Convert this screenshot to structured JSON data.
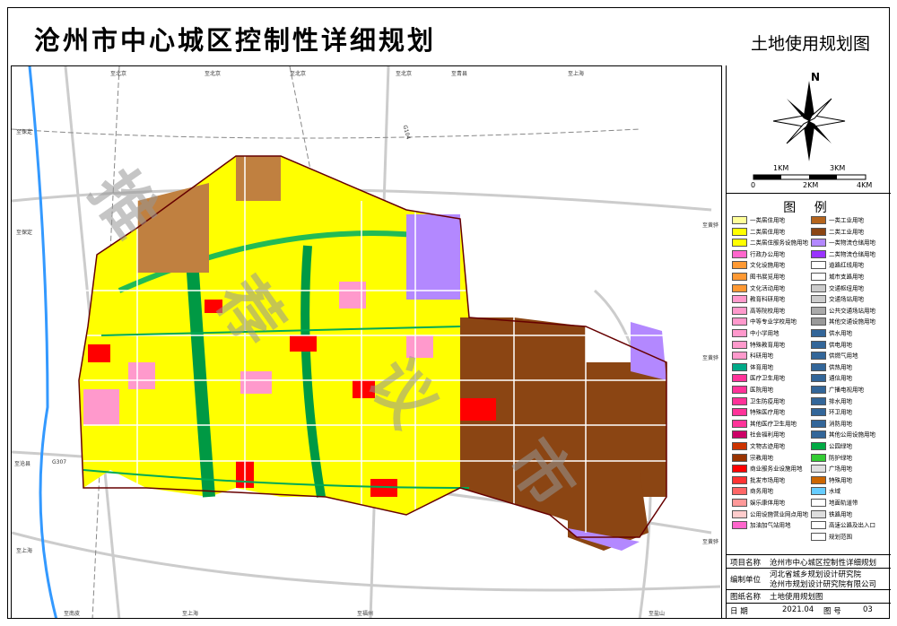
{
  "header": {
    "title": "沧州市中心城区控制性详细规划",
    "subtitle": "土地使用规划图"
  },
  "map": {
    "labels": [
      "至北京",
      "至北京",
      "至北京",
      "至北京",
      "至青县",
      "至上海",
      "至保定",
      "至保定",
      "至黄骅",
      "至黄骅",
      "至沧县",
      "G307",
      "至上海",
      "至南皮",
      "至上海",
      "至盐山",
      "至福州",
      "至黄骅",
      "G104"
    ],
    "watermark": [
      "推",
      "荐",
      "议",
      "市"
    ]
  },
  "compass": {
    "north": "N",
    "scale_top": [
      "1KM",
      "3KM"
    ],
    "scale_bottom": [
      "0",
      "2KM",
      "4KM"
    ]
  },
  "legend": {
    "title": "图 例",
    "left": [
      {
        "label": "一类居住用地",
        "color": "#ffff99"
      },
      {
        "label": "二类居住用地",
        "color": "#ffff00"
      },
      {
        "label": "二类居住服务设施用地",
        "color": "#ffff00"
      },
      {
        "label": "行政办公用地",
        "color": "#ff66cc"
      },
      {
        "label": "文化设施用地",
        "color": "#ff9933"
      },
      {
        "label": "图书展览用地",
        "color": "#ff9933"
      },
      {
        "label": "文化活动用地",
        "color": "#ff9933"
      },
      {
        "label": "教育科研用地",
        "color": "#ff99cc"
      },
      {
        "label": "高等院校用地",
        "color": "#ff99cc"
      },
      {
        "label": "中等专业学校用地",
        "color": "#ff99cc"
      },
      {
        "label": "中小学用地",
        "color": "#ff99cc"
      },
      {
        "label": "特殊教育用地",
        "color": "#ff99cc"
      },
      {
        "label": "科研用地",
        "color": "#ff99cc"
      },
      {
        "label": "体育用地",
        "color": "#00aa88"
      },
      {
        "label": "医疗卫生用地",
        "color": "#ff3399"
      },
      {
        "label": "医院用地",
        "color": "#ff3399"
      },
      {
        "label": "卫生防疫用地",
        "color": "#ff3399"
      },
      {
        "label": "特殊医疗用地",
        "color": "#ff3399"
      },
      {
        "label": "其他医疗卫生用地",
        "color": "#ff3399"
      },
      {
        "label": "社会福利用地",
        "color": "#cc0066"
      },
      {
        "label": "文物古迹用地",
        "color": "#cc3300"
      },
      {
        "label": "宗教用地",
        "color": "#993300"
      },
      {
        "label": "商业服务业设施用地",
        "color": "#ff0000"
      },
      {
        "label": "批发市场用地",
        "color": "#ff3333"
      },
      {
        "label": "商务用地",
        "color": "#ff6666"
      },
      {
        "label": "娱乐康体用地",
        "color": "#ff9999"
      },
      {
        "label": "公用设施营业网点用地",
        "color": "#ffcccc"
      },
      {
        "label": "加油加气站用地",
        "color": "#ff66cc"
      }
    ],
    "right": [
      {
        "label": "一类工业用地",
        "color": "#b5651d"
      },
      {
        "label": "二类工业用地",
        "color": "#8b4513"
      },
      {
        "label": "一类物流仓储用地",
        "color": "#b388ff"
      },
      {
        "label": "二类物流仓储用地",
        "color": "#9933ff"
      },
      {
        "label": "道路红线用地",
        "color": "#ffffff"
      },
      {
        "label": "城市支路用地",
        "color": "#ffffff"
      },
      {
        "label": "交通枢纽用地",
        "color": "#cccccc"
      },
      {
        "label": "交通场站用地",
        "color": "#cccccc"
      },
      {
        "label": "公共交通场站用地",
        "color": "#aaaaaa"
      },
      {
        "label": "其他交通设施用地",
        "color": "#999999"
      },
      {
        "label": "供水用地",
        "color": "#336699"
      },
      {
        "label": "供电用地",
        "color": "#336699"
      },
      {
        "label": "供燃气用地",
        "color": "#336699"
      },
      {
        "label": "供热用地",
        "color": "#336699"
      },
      {
        "label": "通信用地",
        "color": "#336699"
      },
      {
        "label": "广播电视用地",
        "color": "#336699"
      },
      {
        "label": "排水用地",
        "color": "#336699"
      },
      {
        "label": "环卫用地",
        "color": "#336699"
      },
      {
        "label": "消防用地",
        "color": "#336699"
      },
      {
        "label": "其他公用设施用地",
        "color": "#336699"
      },
      {
        "label": "公园绿地",
        "color": "#00aa44"
      },
      {
        "label": "防护绿地",
        "color": "#33cc33"
      },
      {
        "label": "广场用地",
        "color": "#e0e0e0"
      },
      {
        "label": "特殊用地",
        "color": "#cc6600"
      },
      {
        "label": "水域",
        "color": "#66ccff"
      },
      {
        "label": "地面轨道带",
        "color": "#ffffff"
      },
      {
        "label": "铁路用地",
        "color": "#dddddd"
      },
      {
        "label": "高速公路及出入口",
        "color": "#ffffff"
      },
      {
        "label": "规划范围",
        "color": "#ffffff"
      }
    ]
  },
  "title_block": {
    "project_key": "项目名称",
    "project_val": "沧州市中心城区控制性详细规划",
    "unit_key": "编制单位",
    "unit_val1": "河北省城乡规划设计研究院",
    "unit_val2": "沧州市规划设计研究院有限公司",
    "drawing_key": "图纸名称",
    "drawing_val": "土地使用规划图",
    "date_key": "日 期",
    "date_val": "2021.04",
    "num_key": "图 号",
    "num_val": "03"
  }
}
